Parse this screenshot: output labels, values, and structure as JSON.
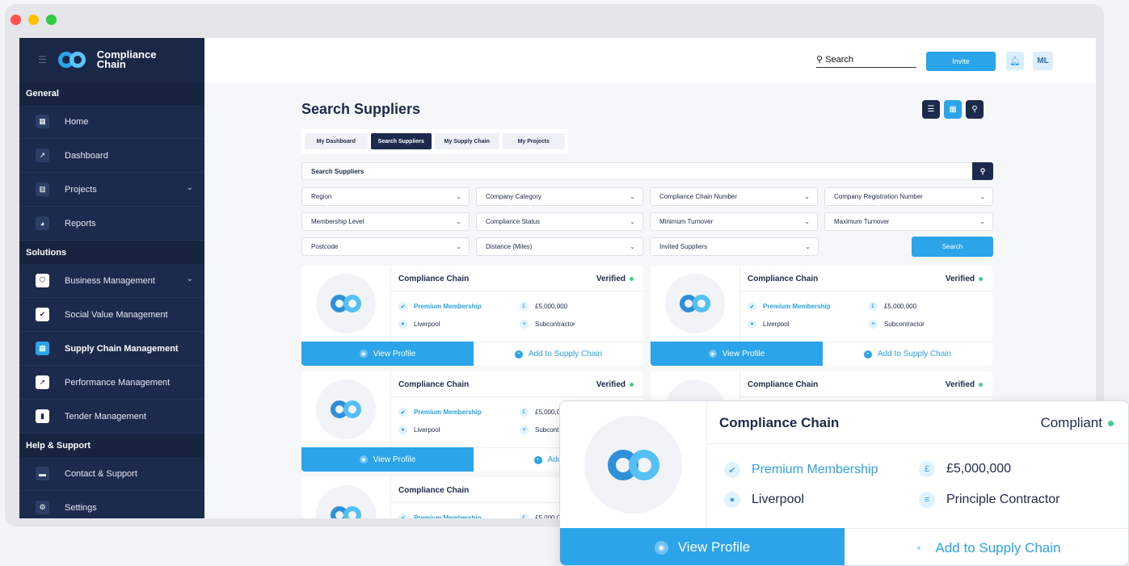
{
  "window": {
    "dot_colors": [
      "#ff4f4f",
      "#ffc107",
      "#2ecc40"
    ]
  },
  "sidebar": {
    "brand_line1": "Compliance",
    "brand_line2": "Chain",
    "sections": {
      "general": "General",
      "solutions": "Solutions",
      "help": "Help & Support"
    },
    "general_items": [
      {
        "label": "Home",
        "icon": "grid-icon"
      },
      {
        "label": "Dashboard",
        "icon": "chart-icon"
      },
      {
        "label": "Projects",
        "icon": "building-icon"
      },
      {
        "label": "Reports",
        "icon": "pie-icon"
      }
    ],
    "solution_items": [
      {
        "label": "Business Management",
        "icon": "shield-icon"
      },
      {
        "label": "Social Value Management",
        "icon": "people-icon"
      },
      {
        "label": "Supply Chain Management",
        "icon": "chain-icon"
      },
      {
        "label": "Performance Management",
        "icon": "trend-icon"
      },
      {
        "label": "Tender Management",
        "icon": "document-icon"
      }
    ],
    "help_items": [
      {
        "label": "Contact & Support",
        "icon": "chat-icon"
      },
      {
        "label": "Settings",
        "icon": "gear-icon"
      }
    ]
  },
  "topbar": {
    "search_label": "Search",
    "invite_label": "Invite",
    "avatar_initials": "ML"
  },
  "main": {
    "title": "Search Suppliers",
    "tabs": [
      "My Dashboard",
      "Search Suppliers",
      "My Supply Chain",
      "My Projects"
    ],
    "active_tab": "Search Suppliers",
    "search_value": "Search Suppliers",
    "filters": [
      "Region",
      "Company Category",
      "Compliance Chain Number",
      "Company Registration Number",
      "Membership Level",
      "Compliance Status",
      "Minimum Turnover",
      "Maximum Turnover",
      "Postcode",
      "Distance (Miles)",
      "Invited Suppliers"
    ],
    "search_button": "Search"
  },
  "card": {
    "name": "Compliance Chain",
    "status": "Verified",
    "membership": "Premium Membership",
    "turnover": "£5,000,000",
    "location": "Liverpool",
    "partial_turnover": "£5,000,0",
    "contractor_type": "Subcontractor",
    "partial_contractor": "Subcont",
    "view_label": "View Profile",
    "add_label": "Add to Supply Chain",
    "partial_add": "Add to Su"
  },
  "zoom_card": {
    "name": "Compliance Chain",
    "status": "Compliant",
    "membership": "Premium Membership",
    "turnover": "£5,000,000",
    "location": "Liverpool",
    "contractor_type": "Principle Contractor",
    "view_label": "View Profile",
    "add_label": "Add to Supply Chain"
  },
  "colors": {
    "accent": "#2ba4ea",
    "navy": "#1c2a4d",
    "status_green": "#3fcf8e"
  }
}
